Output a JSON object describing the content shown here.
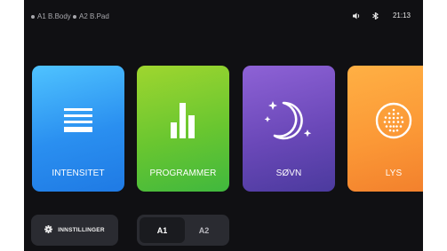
{
  "status_bar": {
    "devices": [
      {
        "label": "A1 B.Body"
      },
      {
        "label": "A2 B.Pad"
      }
    ],
    "time": "21:13",
    "icons": [
      "speaker-icon",
      "bluetooth-icon"
    ]
  },
  "tiles": [
    {
      "label": "INTENSITET",
      "icon": "menu-lines-icon",
      "color": "#2a8ff0"
    },
    {
      "label": "PROGRAMMER",
      "icon": "bar-chart-icon",
      "color": "#69c630"
    },
    {
      "label": "SØVN",
      "icon": "moon-stars-icon",
      "color": "#6a48b8"
    },
    {
      "label": "LYS",
      "icon": "light-dots-icon",
      "color": "#fb9836"
    }
  ],
  "settings_button": {
    "label": "INNSTILLINGER",
    "icon": "gear-icon"
  },
  "device_selector": {
    "options": [
      "A1",
      "A2"
    ],
    "selected": "A1"
  }
}
